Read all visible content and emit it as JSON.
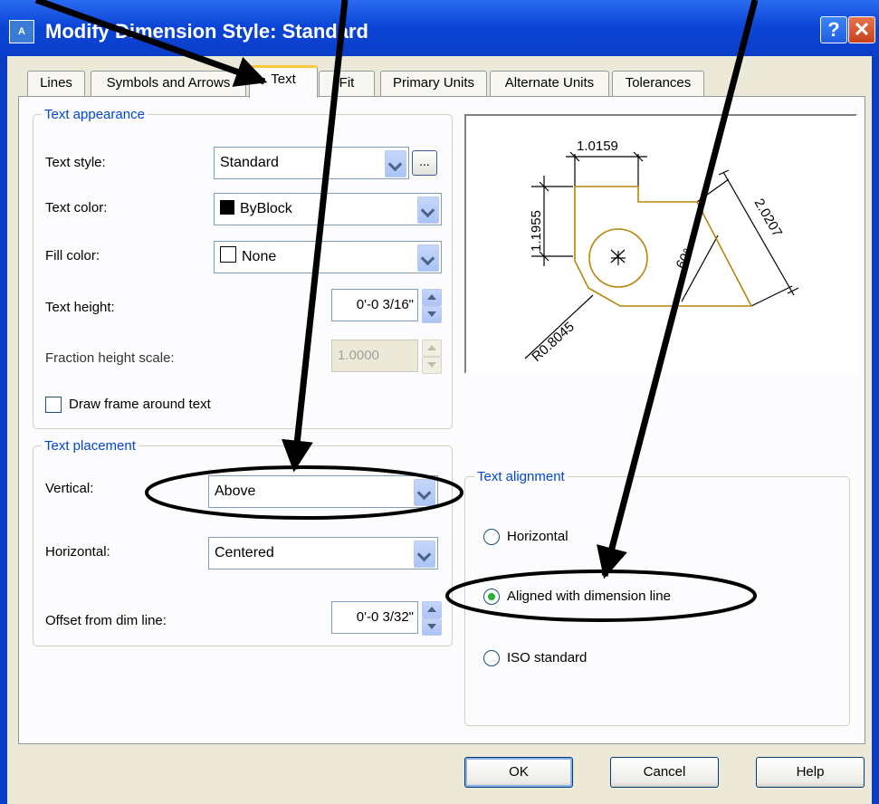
{
  "window": {
    "title": "Modify Dimension Style: Standard",
    "help_glyph": "?",
    "close_glyph": "✕",
    "app_icon": "autocad-icon"
  },
  "tabs": [
    "Lines",
    "Symbols and Arrows",
    "Text",
    "Fit",
    "Primary Units",
    "Alternate Units",
    "Tolerances"
  ],
  "active_tab": "Text",
  "text_appearance": {
    "legend": "Text appearance",
    "text_style_label": "Text style:",
    "text_style_value": "Standard",
    "browse_label": "...",
    "text_color_label": "Text color:",
    "text_color_value": "ByBlock",
    "text_color_swatch": "#000000",
    "fill_color_label": "Fill color:",
    "fill_color_value": "None",
    "text_height_label": "Text height:",
    "text_height_value": "0'-0 3/16\"",
    "fraction_label": "Fraction height scale:",
    "fraction_value": "1.0000",
    "frame_label": "Draw frame around text",
    "frame_checked": false
  },
  "text_placement": {
    "legend": "Text placement",
    "vertical_label": "Vertical:",
    "vertical_value": "Above",
    "horizontal_label": "Horizontal:",
    "horizontal_value": "Centered",
    "offset_label": "Offset from dim line:",
    "offset_value": "0'-0 3/32\""
  },
  "preview": {
    "dim_top": "1.0159",
    "dim_left": "1.1955",
    "dim_slant": "2.0207",
    "dim_angle": "60°",
    "dim_radius": "R0.8045",
    "center_mark": "+",
    "line_color": "#b8860b"
  },
  "text_alignment": {
    "legend": "Text alignment",
    "options": [
      "Horizontal",
      "Aligned with dimension line",
      "ISO standard"
    ],
    "selected": "Aligned with dimension line"
  },
  "buttons": {
    "ok": "OK",
    "cancel": "Cancel",
    "help": "Help"
  }
}
